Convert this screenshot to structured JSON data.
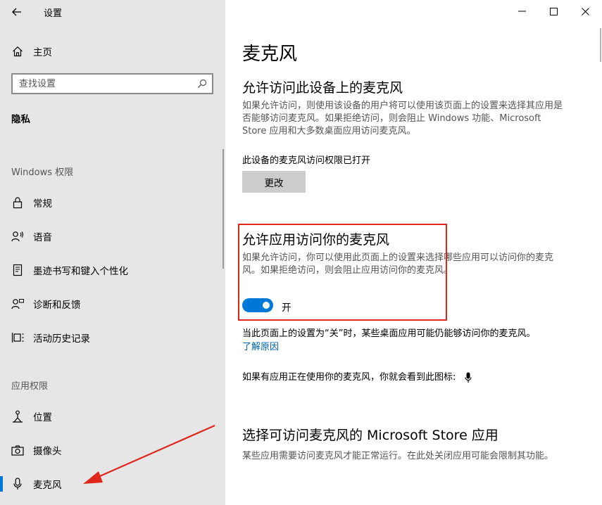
{
  "window": {
    "title": "设置",
    "minimize_label": "minimize",
    "maximize_label": "maximize",
    "close_label": "close"
  },
  "sidebar": {
    "home_label": "主页",
    "search_placeholder": "查找设置",
    "section_title": "隐私",
    "groups": [
      {
        "header": "Windows 权限",
        "items": [
          {
            "label": "常规",
            "icon": "lock-icon"
          },
          {
            "label": "语音",
            "icon": "speech-icon"
          },
          {
            "label": "墨迹书写和键入个性化",
            "icon": "inking-icon"
          },
          {
            "label": "诊断和反馈",
            "icon": "feedback-icon"
          },
          {
            "label": "活动历史记录",
            "icon": "timeline-icon"
          }
        ]
      },
      {
        "header": "应用权限",
        "items": [
          {
            "label": "位置",
            "icon": "location-icon"
          },
          {
            "label": "摄像头",
            "icon": "camera-icon"
          },
          {
            "label": "麦克风",
            "icon": "microphone-icon",
            "selected": true
          }
        ]
      }
    ]
  },
  "main": {
    "page_title": "麦克风",
    "device_section": {
      "heading": "允许访问此设备上的麦克风",
      "description": "如果允许访问，则使用该设备的用户将可以使用该页面上的设置来选择其应用是否能够访问麦克风。如果拒绝访问，则会阻止 Windows 功能、Microsoft Store 应用和大多数桌面应用访问麦克风。",
      "status": "此设备的麦克风访问权限已打开",
      "change_button": "更改"
    },
    "app_section": {
      "heading": "允许应用访问你的麦克风",
      "description": "如果允许访问，你可以使用此页面上的设置来选择哪些应用可以访问你的麦克风。如果拒绝访问，则会阻止应用访问你的麦克风。",
      "toggle_on": true,
      "toggle_label": "开"
    },
    "note": "当此页面上的设置为“关”时，某些桌面应用可能仍能够访问你的麦克风。",
    "learn_more": "了解原因",
    "icon_hint": "如果有应用正在使用你的麦克风，你就会看到此图标:",
    "store_section": {
      "heading": "选择可访问麦克风的 Microsoft Store 应用",
      "description": "某些应用需要访问麦克风才能正常运行。在此处关闭应用可能会限制其功能。"
    }
  },
  "colors": {
    "accent": "#0078d7",
    "annotation": "#e0261b",
    "sidebar_bg": "#e6e6e6"
  }
}
